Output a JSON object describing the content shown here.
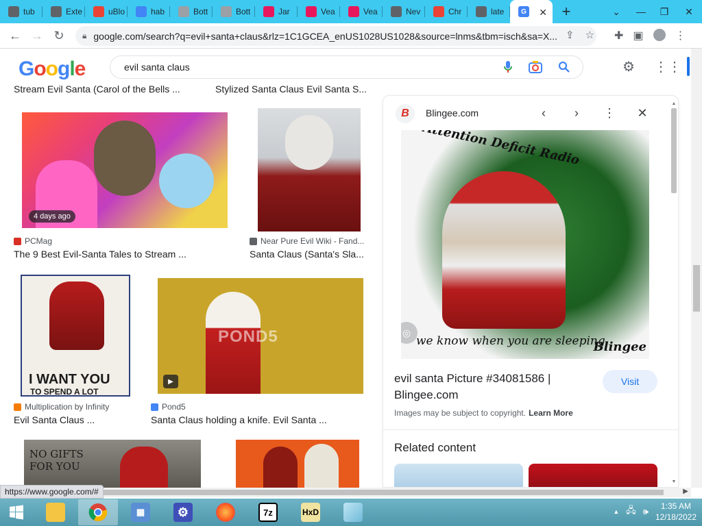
{
  "browser": {
    "tabs": [
      {
        "label": "tub",
        "favicon": "globe-icon",
        "color": "#5f6368"
      },
      {
        "label": "Exte",
        "favicon": "puzzle-icon",
        "color": "#5f6368"
      },
      {
        "label": "uBlo",
        "favicon": "chrome-icon",
        "color": "#ea4335"
      },
      {
        "label": "hab",
        "favicon": "google-g-icon",
        "color": "#4285f4"
      },
      {
        "label": "Bott",
        "favicon": "document-icon",
        "color": "#9aa0a6"
      },
      {
        "label": "Bott",
        "favicon": "document-icon",
        "color": "#9aa0a6"
      },
      {
        "label": "Jar",
        "favicon": "flame-icon",
        "color": "#e8175d"
      },
      {
        "label": "Vea",
        "favicon": "flame-icon",
        "color": "#e8175d"
      },
      {
        "label": "Vea",
        "favicon": "flame-icon",
        "color": "#e8175d"
      },
      {
        "label": "Nev",
        "favicon": "chrome-icon",
        "color": "#5f6368"
      },
      {
        "label": "Chr",
        "favicon": "chrome-icon",
        "color": "#ea4335"
      },
      {
        "label": "late",
        "favicon": "globe-icon",
        "color": "#5f6368"
      },
      {
        "label": "G",
        "favicon": "google-g-icon",
        "color": "#4285f4"
      }
    ],
    "url": "google.com/search?q=evil+santa+claus&rlz=1C1GCEA_enUS1028US1028&source=lnms&tbm=isch&sa=X..."
  },
  "google": {
    "logo": "Google",
    "query": "evil santa claus"
  },
  "results": {
    "top_captions": [
      "Stream Evil Santa (Carol of the Bells ...",
      "Stylized Santa Claus Evil Santa S..."
    ],
    "items": [
      {
        "source": "PCMag",
        "title": "The 9 Best Evil-Santa Tales to Stream ...",
        "badge": "4 days ago",
        "src_color": "#d93025"
      },
      {
        "source": "Near Pure Evil Wiki - Fand...",
        "title": "Santa Claus (Santa's Sla...",
        "src_color": "#5f6368"
      },
      {
        "source": "Multiplication by Infinity",
        "title": "Evil Santa Claus ...",
        "src_color": "#f57c00"
      },
      {
        "source": "Pond5",
        "title": "Santa Claus holding a knife. Evil Santa ...",
        "src_color": "#4285f4"
      }
    ],
    "poster_text": [
      "I WANT YOU",
      "TO SPEND A LOT"
    ],
    "watermark": "POND5",
    "sign_text": [
      "NO GIFTS",
      "FOR YOU"
    ]
  },
  "panel": {
    "site": "Blingee.com",
    "image_caption_top": "Attention Deficit Radio",
    "image_caption_bottom": "we know when you are sleeping",
    "image_logo": "Blingee",
    "title": "evil santa Picture #34081586 | Blingee.com",
    "visit": "Visit",
    "copyright": "Images may be subject to copyright.",
    "learn_more": "Learn More",
    "related": "Related content"
  },
  "status_url": "https://www.google.com/#",
  "taskbar": {
    "apps": [
      "start-button",
      "file-explorer-icon",
      "chrome-icon",
      "control-panel-icon",
      "settings-gear-icon",
      "firefox-icon",
      "7zip-icon",
      "hxd-icon",
      "notepad-icon"
    ],
    "time": "1:35 AM",
    "date": "12/18/2022"
  },
  "colors": {
    "tabstrip": "#3ec9f0",
    "taskbar": "#5aa6ba",
    "link_blue": "#1a73e8"
  }
}
